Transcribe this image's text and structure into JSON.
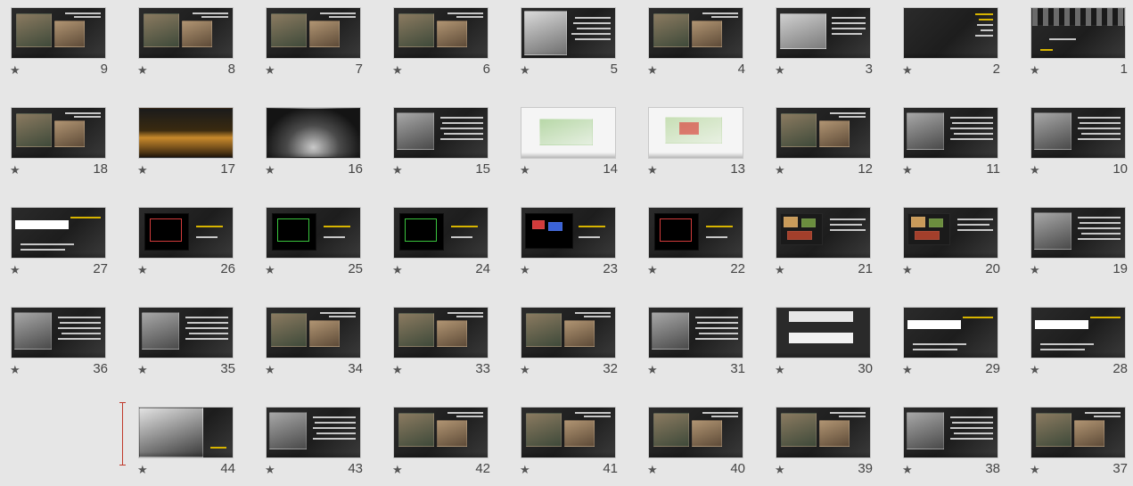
{
  "view": "slide-sorter",
  "star_glyph": "★",
  "colors": {
    "background": "#e6e6e6",
    "slide_dark": "#1f1f1f",
    "accent_yellow": "#d7b400",
    "insertion_marker": "#c0392b"
  },
  "rows": [
    {
      "slides": [
        {
          "number": "9",
          "theme": "photos-dark"
        },
        {
          "number": "8",
          "theme": "photos-dark"
        },
        {
          "number": "7",
          "theme": "photos-dark"
        },
        {
          "number": "6",
          "theme": "photos-dark"
        },
        {
          "number": "5",
          "theme": "portrait-text"
        },
        {
          "number": "4",
          "theme": "photos-dark"
        },
        {
          "number": "3",
          "theme": "model-text"
        },
        {
          "number": "2",
          "theme": "text-yellow"
        },
        {
          "number": "1",
          "theme": "title-dark"
        }
      ]
    },
    {
      "slides": [
        {
          "number": "18",
          "theme": "photos-dark"
        },
        {
          "number": "17",
          "theme": "night-photo"
        },
        {
          "number": "16",
          "theme": "vault-photo"
        },
        {
          "number": "15",
          "theme": "photo-text"
        },
        {
          "number": "14",
          "theme": "site-plan"
        },
        {
          "number": "13",
          "theme": "site-plan-red"
        },
        {
          "number": "12",
          "theme": "photos-dark"
        },
        {
          "number": "11",
          "theme": "photo-text"
        },
        {
          "number": "10",
          "theme": "photo-text"
        }
      ]
    },
    {
      "slides": [
        {
          "number": "27",
          "theme": "white-bar"
        },
        {
          "number": "26",
          "theme": "cad-red"
        },
        {
          "number": "25",
          "theme": "cad-green"
        },
        {
          "number": "24",
          "theme": "cad-green"
        },
        {
          "number": "23",
          "theme": "cad-color"
        },
        {
          "number": "22",
          "theme": "cad-red"
        },
        {
          "number": "21",
          "theme": "plan-color"
        },
        {
          "number": "20",
          "theme": "plan-color"
        },
        {
          "number": "19",
          "theme": "photo-text"
        }
      ]
    },
    {
      "slides": [
        {
          "number": "36",
          "theme": "photo-text"
        },
        {
          "number": "35",
          "theme": "photo-text"
        },
        {
          "number": "34",
          "theme": "photos-dark"
        },
        {
          "number": "33",
          "theme": "photos-dark"
        },
        {
          "number": "32",
          "theme": "photos-dark"
        },
        {
          "number": "31",
          "theme": "photo-text"
        },
        {
          "number": "30",
          "theme": "section"
        },
        {
          "number": "29",
          "theme": "white-bar"
        },
        {
          "number": "28",
          "theme": "white-bar"
        }
      ]
    },
    {
      "slides": [
        {
          "number": "44",
          "theme": "portrait-bw"
        },
        {
          "number": "43",
          "theme": "photo-text"
        },
        {
          "number": "42",
          "theme": "photos-dark"
        },
        {
          "number": "41",
          "theme": "photos-dark"
        },
        {
          "number": "40",
          "theme": "photos-dark"
        },
        {
          "number": "39",
          "theme": "photos-dark"
        },
        {
          "number": "38",
          "theme": "photo-text"
        },
        {
          "number": "37",
          "theme": "photos-dark"
        }
      ]
    }
  ]
}
